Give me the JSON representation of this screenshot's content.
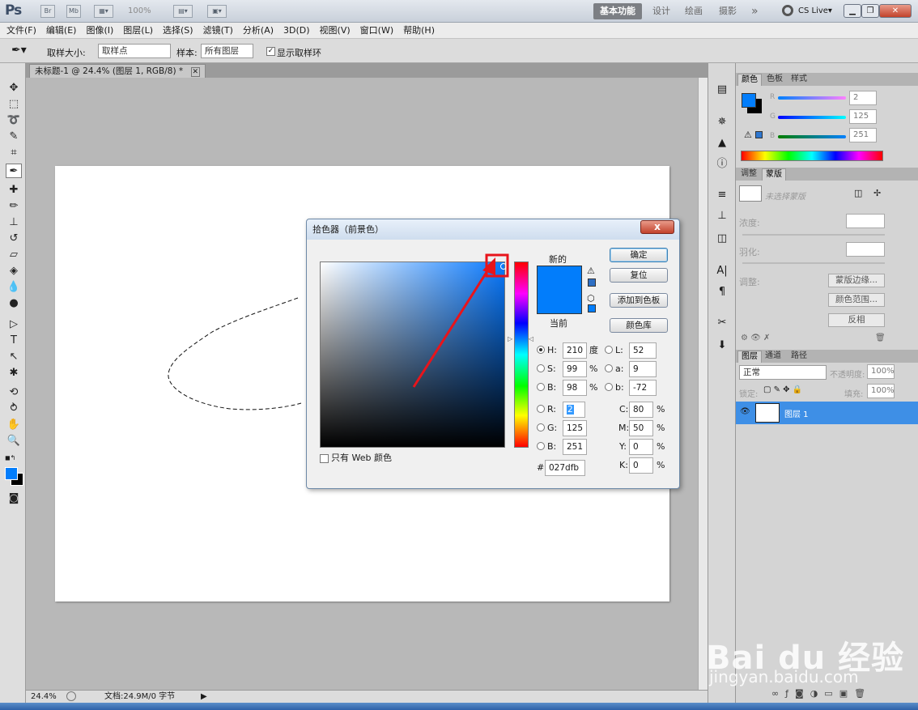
{
  "titlebar": {
    "app_logo": "Ps",
    "bridge": "Br",
    "mini": "Mb",
    "zoom": "100%",
    "workspaces": [
      "基本功能",
      "设计",
      "绘画",
      "摄影"
    ],
    "more": "»",
    "cslive": "CS Live▾"
  },
  "menu": [
    "文件(F)",
    "编辑(E)",
    "图像(I)",
    "图层(L)",
    "选择(S)",
    "滤镜(T)",
    "分析(A)",
    "3D(D)",
    "视图(V)",
    "窗口(W)",
    "帮助(H)"
  ],
  "options": {
    "sample_size_label": "取样大小:",
    "sample_size_value": "取样点",
    "sample_label": "样本:",
    "sample_value": "所有图层",
    "show_ring_label": "显示取样环"
  },
  "document": {
    "tab_label": "未标题-1 @ 24.4% (图层 1, RGB/8) *",
    "zoom": "24.4%",
    "doc_info": "文档:24.9M/0 字节"
  },
  "color_panel": {
    "tabs": [
      "颜色",
      "色板",
      "样式"
    ],
    "r": "2",
    "g": "125",
    "b": "251",
    "r_label": "R",
    "g_label": "G",
    "b_label": "B"
  },
  "adjust_panel": {
    "tabs": [
      "调整",
      "蒙版"
    ],
    "mask_none": "未选择蒙版",
    "density": "浓度:",
    "feather": "羽化:",
    "refine": "调整:",
    "mask_edge": "蒙版边缘...",
    "color_range": "颜色范围...",
    "invert": "反相"
  },
  "layers_panel": {
    "tabs": [
      "图层",
      "通道",
      "路径"
    ],
    "blend": "正常",
    "opacity_label": "不透明度:",
    "opacity": "100%",
    "lock_label": "锁定:",
    "fill_label": "填充:",
    "fill": "100%",
    "layer_name": "图层 1"
  },
  "dialog": {
    "title": "拾色器（前景色）",
    "close": "x",
    "new_label": "新的",
    "current_label": "当前",
    "ok": "确定",
    "reset": "复位",
    "add_swatch": "添加到色板",
    "libraries": "颜色库",
    "web_only": "只有 Web 颜色",
    "h_label": "H:",
    "h": "210",
    "h_unit": "度",
    "s_label": "S:",
    "s": "99",
    "s_unit": "%",
    "bb_label": "B:",
    "bb": "98",
    "bb_unit": "%",
    "r_label": "R:",
    "r": "2",
    "g_label": "G:",
    "g": "125",
    "b_label": "B:",
    "b": "251",
    "l_label": "L:",
    "l": "52",
    "a_label": "a:",
    "a": "9",
    "lab_b_label": "b:",
    "lab_b": "-72",
    "c_label": "C:",
    "c": "80",
    "m_label": "M:",
    "m": "50",
    "y_label": "Y:",
    "y": "0",
    "k_label": "K:",
    "k": "0",
    "pct": "%",
    "hex_label": "#",
    "hex": "027dfb"
  },
  "colors": {
    "selected": "#027dfb",
    "annotation": "#e8141b"
  },
  "watermark": {
    "brand": "Bai du 经验",
    "url": "jingyan.baidu.com"
  }
}
